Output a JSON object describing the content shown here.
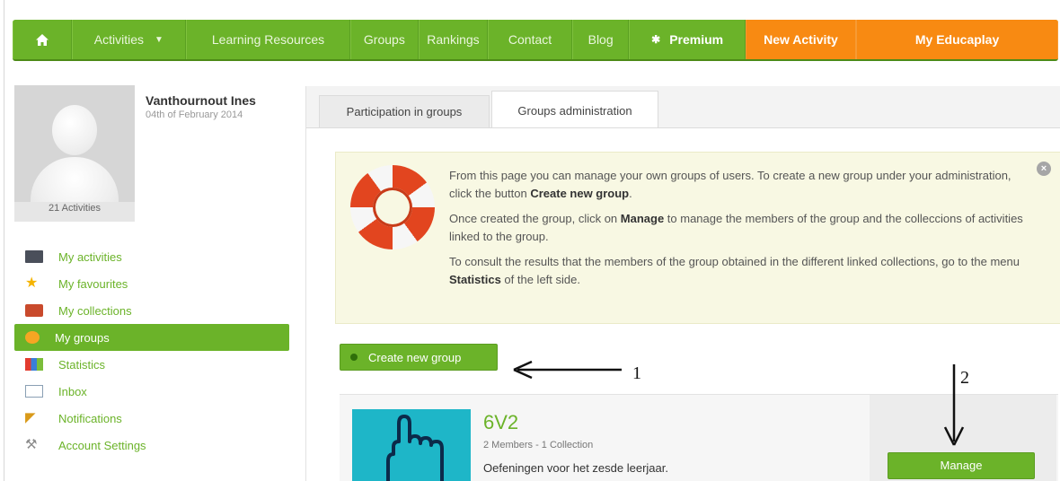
{
  "nav": {
    "home_icon": "home-icon",
    "items": [
      "Activities",
      "Learning Resources",
      "Groups",
      "Rankings",
      "Contact",
      "Blog"
    ],
    "premium": "Premium",
    "new_activity": "New Activity",
    "my_educaplay": "My Educaplay",
    "colors": {
      "green": "#6bb329",
      "orange": "#f88a12"
    }
  },
  "profile": {
    "name": "Vanthournout Ines",
    "date": "04th of February 2014",
    "activities_count": "21 Activities"
  },
  "sidebar": {
    "items": [
      {
        "label": "My activities",
        "icon": "activities-icon"
      },
      {
        "label": "My favourites",
        "icon": "star-icon"
      },
      {
        "label": "My collections",
        "icon": "collections-icon"
      },
      {
        "label": "My groups",
        "icon": "groups-icon",
        "active": true
      },
      {
        "label": "Statistics",
        "icon": "stats-icon"
      },
      {
        "label": "Inbox",
        "icon": "envelope-icon"
      },
      {
        "label": "Notifications",
        "icon": "megaphone-icon"
      },
      {
        "label": "Account Settings",
        "icon": "wrench-icon"
      }
    ]
  },
  "tabs": [
    "Participation in groups",
    "Groups administration"
  ],
  "help": {
    "p1_text": "From this page you can manage your own groups of users. To create a new group under your administration, click the button ",
    "p1_bold": "Create new group",
    "p1_end": ".",
    "p2_start": "Once created the group, click on ",
    "p2_bold": "Manage",
    "p2_text": " to manage the members of the group and the colleccions of activities linked to the group.",
    "p3_text": "To consult the results that the members of the group obtained in the different linked collections, go to the menu ",
    "p3_bold": "Statistics",
    "p3_end": " of the left side.",
    "close": "×"
  },
  "create_button": "Create new group",
  "group": {
    "name": "6V2",
    "meta": "2 Members - 1 Collection",
    "description": "Oefeningen voor het zesde leerjaar.",
    "manage": "Manage"
  },
  "annotations": [
    "1",
    "2"
  ]
}
